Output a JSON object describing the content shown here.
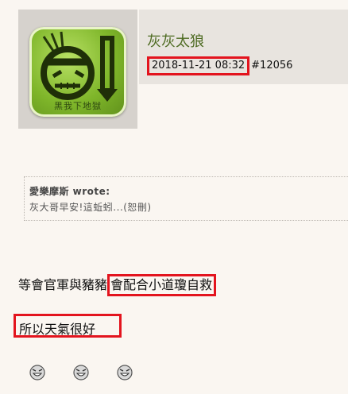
{
  "post": {
    "author": "灰灰太狼",
    "date": "2018-11-21 08:32",
    "post_number": "#12056",
    "avatar_caption": "黑我下地獄",
    "quote": {
      "header": "愛樂摩斯 wrote:",
      "body": "灰大哥早安!這蚯蚓...(恕刪)"
    },
    "body_line1_prefix": "等會官軍與豬豬",
    "body_line1_highlight": "會配合小道瓊自救",
    "body_line2": "所以天氣很好",
    "smileys": [
      "grin-smiley-icon",
      "grin-smiley-icon",
      "grin-smiley-icon"
    ]
  },
  "colors": {
    "highlight_border": "#e3141e",
    "author_name": "#4e6b22",
    "page_background": "#faf6f1",
    "header_background": "#e8e4df"
  }
}
